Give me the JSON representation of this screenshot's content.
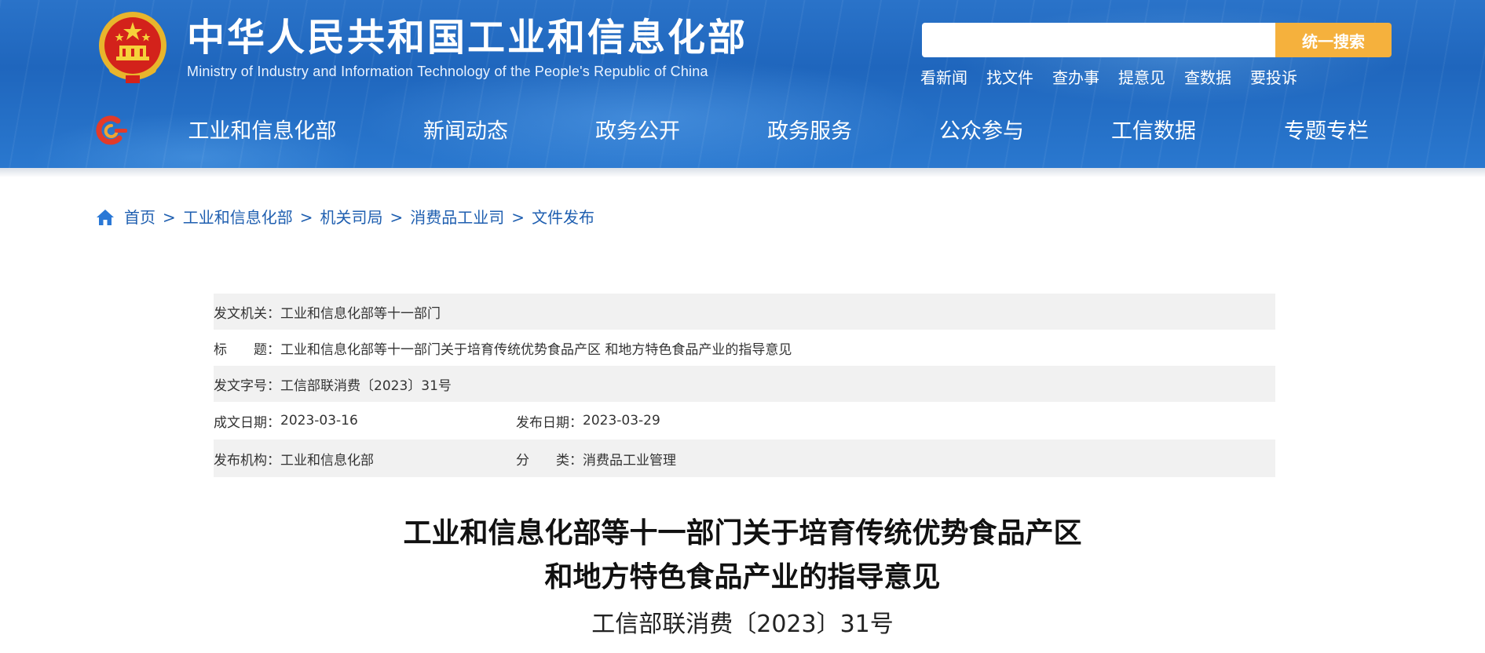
{
  "header": {
    "title": "中华人民共和国工业和信息化部",
    "subtitle": "Ministry of Industry and Information Technology of the People's Republic of China",
    "search": {
      "placeholder": "",
      "button_label": "统一搜索"
    },
    "quick_links": [
      "看新闻",
      "找文件",
      "查办事",
      "提意见",
      "查数据",
      "要投诉"
    ],
    "nav": [
      "工业和信息化部",
      "新闻动态",
      "政务公开",
      "政务服务",
      "公众参与",
      "工信数据",
      "专题专栏"
    ]
  },
  "breadcrumb": {
    "icon": "home-icon",
    "items": [
      "首页",
      "工业和信息化部",
      "机关司局",
      "消费品工业司",
      "文件发布"
    ],
    "separator": ">"
  },
  "meta": {
    "issuer_label": "发文机关：",
    "issuer": "工业和信息化部等十一部门",
    "title_label": "标　　题：",
    "title": "工业和信息化部等十一部门关于培育传统优势食品产区 和地方特色食品产业的指导意见",
    "doc_no_label": "发文字号：",
    "doc_no": "工信部联消费〔2023〕31号",
    "written_label": "成文日期：",
    "written": "2023-03-16",
    "published_label": "发布日期：",
    "published": "2023-03-29",
    "org_label": "发布机构：",
    "org": "工业和信息化部",
    "category_label": "分　　类：",
    "category": "消费品工业管理"
  },
  "document": {
    "title_line1": "工业和信息化部等十一部门关于培育传统优势食品产区",
    "title_line2": "和地方特色食品产业的指导意见",
    "number": "工信部联消费〔2023〕31号"
  },
  "colors": {
    "header_blue": "#1f66bd",
    "search_button": "#f5b13d",
    "link_blue": "#1f5fb0",
    "row_shade": "#f1f1f1"
  }
}
